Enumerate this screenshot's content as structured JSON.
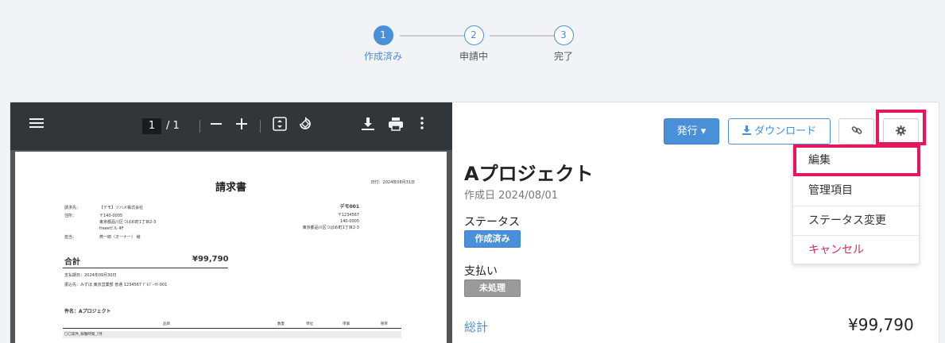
{
  "stepper": {
    "steps": [
      {
        "number": "1",
        "label": "作成済み",
        "active": true
      },
      {
        "number": "2",
        "label": "申請中",
        "active": false
      },
      {
        "number": "3",
        "label": "完了",
        "active": false
      }
    ]
  },
  "pdf_viewer": {
    "current_page": "1",
    "total_pages": "/ 1",
    "document": {
      "title": "請求書",
      "date": "日付：2024年08月31日",
      "billing_to_label": "請求先：",
      "billing_to": "【デモ】ツバメ株式会社",
      "address_label": "住所：",
      "postal": "〒140-0005",
      "address1": "東京都品川区つばめ町1丁目2-3",
      "address2": "freeeビル 4F",
      "person_label": "担当：",
      "person": "燕一郎（オーナー） 様",
      "issuer": "デモ001",
      "issuer_postal": "〒1234567",
      "issuer_zip": "140-0005",
      "issuer_address": "東京都品川区つばめ町1丁目2-3",
      "total_label": "合計",
      "total_value": "¥99,790",
      "due": "支払期日：2024年09月30日",
      "bank": "振込先：みずほ 東京営業部 普通 1234567 ﾃﾞﾓﾌﾞ-ｲﾁ-001",
      "project": "件名：Aプロジェクト",
      "col_item": "品目",
      "col_qty": "数量",
      "col_unit": "単位",
      "col_price": "単価",
      "col_tax": "税率",
      "row1": "〇〇案件_稼働時間_7月"
    }
  },
  "toolbar": {
    "publish_label": "発行 ▾",
    "download_label": "ダウンロード"
  },
  "detail": {
    "title": "Aプロジェクト",
    "created": "作成日 2024/08/01",
    "status_label": "ステータス",
    "status_value": "作成済み",
    "payment_label": "支払い",
    "payment_value": "未処理",
    "total_label": "総計",
    "total_value": "¥99,790"
  },
  "menu": {
    "items": [
      "編集",
      "管理項目",
      "ステータス変更",
      "キャンセル"
    ]
  },
  "colors": {
    "accent": "#4a90d9",
    "highlight": "#e8175d",
    "danger": "#d0305e"
  }
}
